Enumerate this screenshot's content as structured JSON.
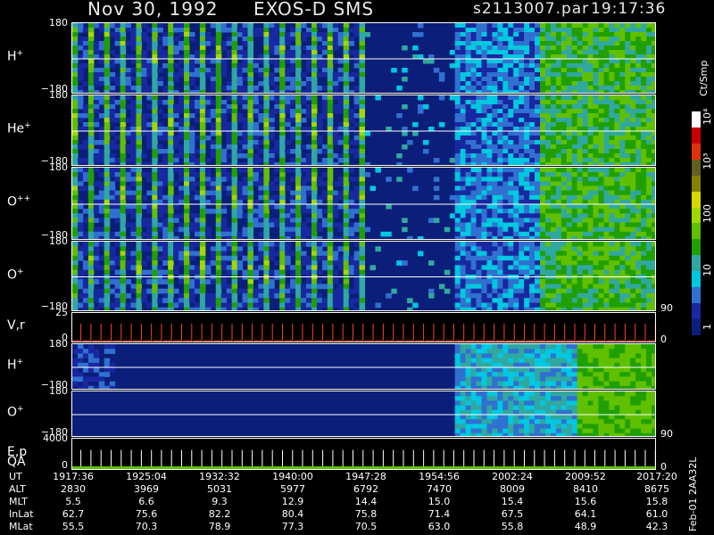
{
  "header": {
    "date": "Nov 30, 1992",
    "instrument": "EXOS-D SMS",
    "file": "s2113007.par",
    "time": "19:17:36"
  },
  "panels": [
    {
      "id": "h1",
      "label": "H",
      "sup": "+",
      "top_tick": "180",
      "bottom_tick": "−180"
    },
    {
      "id": "he1",
      "label": "He",
      "sup": "+",
      "top_tick": "180",
      "bottom_tick": "−180"
    },
    {
      "id": "o2",
      "label": "O",
      "sup": "++",
      "top_tick": "180",
      "bottom_tick": "−180"
    },
    {
      "id": "o1",
      "label": "O",
      "sup": "+",
      "top_tick": "180",
      "bottom_tick": "−180",
      "right_tick": "90"
    },
    {
      "id": "vr",
      "label": "V,r",
      "sup": "",
      "top_tick": "25",
      "bottom_tick": "0",
      "right_tick": "0"
    },
    {
      "id": "h2",
      "label": "H",
      "sup": "+",
      "top_tick": "180",
      "bottom_tick": "−180"
    },
    {
      "id": "o3",
      "label": "O",
      "sup": "+",
      "top_tick": "180",
      "bottom_tick": "−180",
      "right_tick": "90"
    },
    {
      "id": "ep",
      "label": "E,p",
      "sup": "",
      "top_tick": "4000",
      "bottom_tick": "0",
      "right_tick": "0"
    }
  ],
  "qa_label": "QA",
  "colorbar": {
    "unit": "Ct/Smp",
    "ticks": [
      "10⁴",
      "10³",
      "100",
      "10",
      "1"
    ],
    "colors": [
      "#ffffff",
      "#c80000",
      "#e03010",
      "#606020",
      "#888000",
      "#d8d800",
      "#a0d800",
      "#60c000",
      "#20a000",
      "#30a8a0",
      "#00c8e0",
      "#3070d0",
      "#1828a0",
      "#0a1e7a"
    ]
  },
  "table": {
    "rows": [
      {
        "label": "UT",
        "values": [
          "1917:36",
          "1925:04",
          "1932:32",
          "1940:00",
          "1947:28",
          "1954:56",
          "2002:24",
          "2009:52",
          "2017:20"
        ]
      },
      {
        "label": "ALT",
        "values": [
          "2830",
          "3969",
          "5031",
          "5977",
          "6792",
          "7470",
          "8009",
          "8410",
          "8675"
        ]
      },
      {
        "label": "MLT",
        "values": [
          "5.5",
          "6.6",
          "9.3",
          "12.9",
          "14.4",
          "15.0",
          "15.4",
          "15.6",
          "15.8"
        ]
      },
      {
        "label": "InLat",
        "values": [
          "62.7",
          "75.6",
          "82.2",
          "80.4",
          "75.8",
          "71.4",
          "67.5",
          "64.1",
          "61.0"
        ]
      },
      {
        "label": "MLat",
        "values": [
          "55.5",
          "70.3",
          "78.9",
          "77.3",
          "70.5",
          "63.0",
          "55.8",
          "48.9",
          "42.3"
        ]
      }
    ]
  },
  "footer_tag": "Feb-01 2AA32L",
  "chart_data": {
    "type": "heatmap",
    "title": "Nov 30, 1992  EXOS-D SMS  s2113007.par  19:17:36",
    "x_ticks": [
      "1917:36",
      "1925:04",
      "1932:32",
      "1940:00",
      "1947:28",
      "1954:56",
      "2002:24",
      "2009:52",
      "2017:20"
    ],
    "panels": [
      "H+",
      "He+",
      "O++",
      "O+",
      "V,r",
      "H+",
      "O+",
      "E,p"
    ],
    "pitch_angle_range": [
      -180,
      180
    ],
    "vr_range": [
      0,
      25
    ],
    "ep_range": [
      0,
      4000
    ],
    "colorbar_unit": "Ct/Smp",
    "colorbar_range": [
      1,
      10000
    ],
    "colorbar_scale": "log"
  }
}
